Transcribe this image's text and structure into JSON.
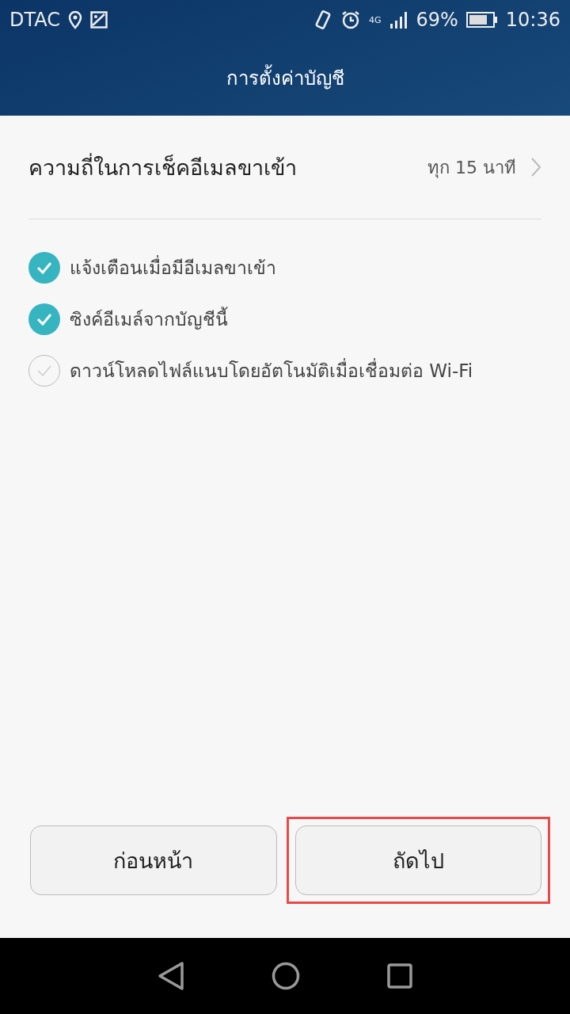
{
  "status_bar": {
    "carrier": "DTAC",
    "network": "4G",
    "battery": "69%",
    "time": "10:36"
  },
  "header": {
    "title": "การตั้งค่าบัญชี"
  },
  "frequency": {
    "label": "ความถี่ในการเช็คอีเมลขาเข้า",
    "value": "ทุก 15 นาที"
  },
  "options": [
    {
      "label": "แจ้งเตือนเมื่อมีอีเมลขาเข้า",
      "checked": true
    },
    {
      "label": "ซิงค์อีเมล์จากบัญชีนี้",
      "checked": true
    },
    {
      "label": "ดาวน์โหลดไฟล์แนบโดยอัตโนมัติเมื่อเชื่อมต่อ Wi-Fi",
      "checked": false
    }
  ],
  "buttons": [
    {
      "label": "ก่อนหน้า",
      "highlighted": false
    },
    {
      "label": "ถัดไป",
      "highlighted": true
    }
  ]
}
